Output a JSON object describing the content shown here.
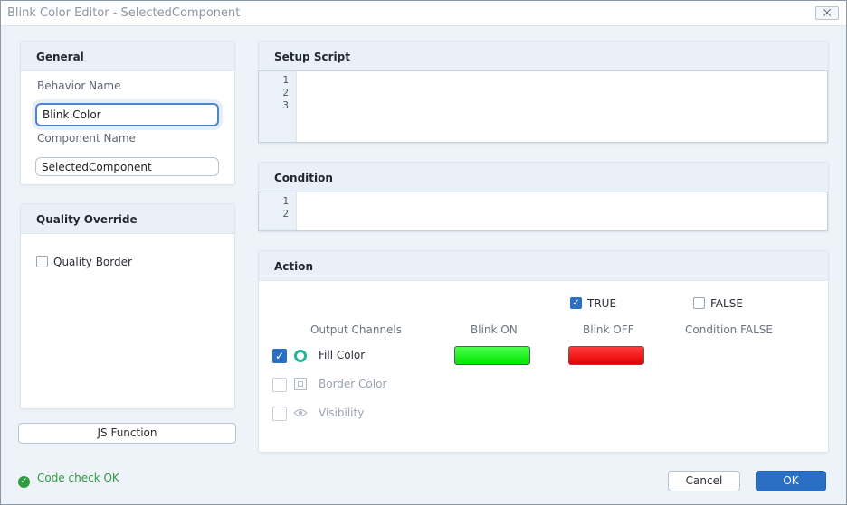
{
  "window": {
    "title": "Blink Color Editor - SelectedComponent",
    "close_label": "⨉"
  },
  "general": {
    "title": "General",
    "behavior_name_label": "Behavior Name",
    "behavior_name_value": "Blink Color",
    "component_name_label": "Component Name",
    "component_name_value": "SelectedComponent"
  },
  "quality": {
    "title": "Quality Override",
    "quality_border_label": "Quality Border",
    "quality_border_checked": false
  },
  "js_function_label": "JS Function",
  "setup_script": {
    "title": "Setup Script",
    "line_numbers": [
      "1",
      "2",
      "3"
    ]
  },
  "condition": {
    "title": "Condition",
    "line_numbers": [
      "1",
      "2"
    ]
  },
  "action": {
    "title": "Action",
    "true_label": "TRUE",
    "true_checked": true,
    "false_label": "FALSE",
    "false_checked": false,
    "col_output_channels": "Output Channels",
    "col_blink_on": "Blink ON",
    "col_blink_off": "Blink OFF",
    "col_condition_false": "Condition FALSE",
    "channels": [
      {
        "label": "Fill Color",
        "icon": "fill-circle-icon",
        "checked": true,
        "enabled": true,
        "blink_on_color": "#00ff00",
        "blink_off_color": "#ff0000"
      },
      {
        "label": "Border Color",
        "icon": "border-square-icon",
        "checked": false,
        "enabled": false
      },
      {
        "label": "Visibility",
        "icon": "eye-icon",
        "checked": false,
        "enabled": false
      }
    ]
  },
  "footer": {
    "status": "Code check OK",
    "cancel_label": "Cancel",
    "ok_label": "OK"
  },
  "colors": {
    "accent": "#2b6fc4",
    "status_ok": "#2e9d3f",
    "fill_icon": "#23b59a"
  }
}
